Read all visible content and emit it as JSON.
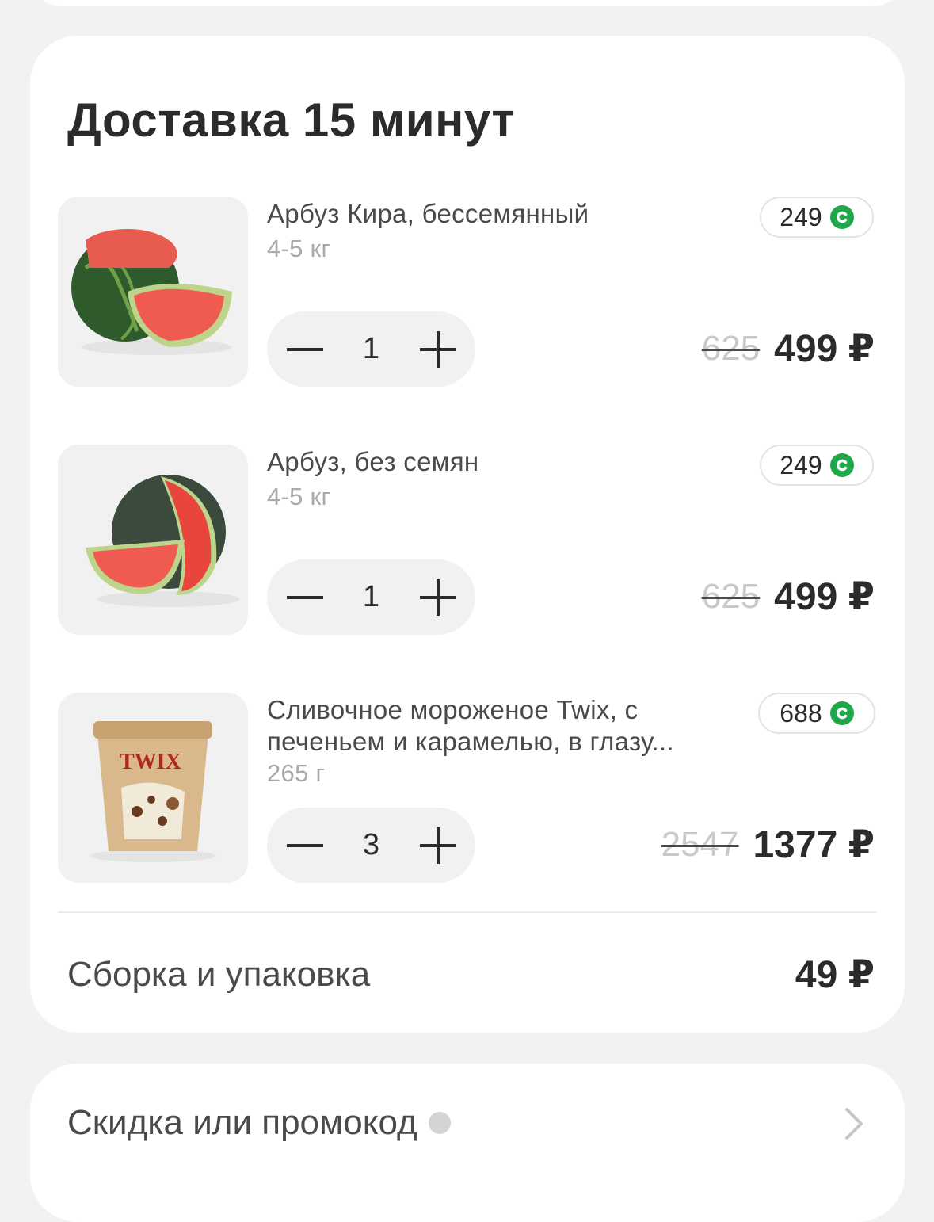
{
  "section": {
    "title": "Доставка 15 минут"
  },
  "items": [
    {
      "name": "Арбуз Кира, бессемянный",
      "weight": "4-5 кг",
      "bonus": "249",
      "quantity": "1",
      "old_price": "625",
      "price": "499 ₽",
      "image": "watermel-whole-slice"
    },
    {
      "name": "Арбуз, без семян",
      "weight": "4-5 кг",
      "bonus": "249",
      "quantity": "1",
      "old_price": "625",
      "price": "499 ₽",
      "image": "watermelon-cut"
    },
    {
      "name": "Сливочное мороженое Twix, с печеньем и карамелью, в глазу...",
      "weight": "265 г",
      "bonus": "688",
      "quantity": "3",
      "old_price": "2547",
      "price": "1377 ₽",
      "image": "twix-ice-cream-tub",
      "image_text": "TWIX"
    }
  ],
  "packing": {
    "label": "Сборка и упаковка",
    "price": "49 ₽"
  },
  "promo": {
    "label": "Скидка или промокод"
  },
  "colors": {
    "bonus_green": "#1fa84a",
    "background": "#f2f2f2",
    "card": "#ffffff"
  }
}
